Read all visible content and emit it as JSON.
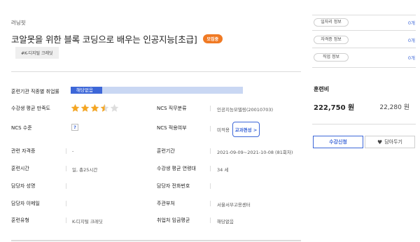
{
  "course": {
    "provider": "러닝핏",
    "title": "코알못을 위한 블록 코딩으로 배우는 인공지능[초급]",
    "badge": "모집중",
    "tag": "#K-디지털 크레딧"
  },
  "details": {
    "employment_rate_label": "훈련기관 직종별 취업률",
    "employment_rate_value": "해당없음",
    "satisfaction_label": "수강생 평균 만족도",
    "satisfaction_stars": 3.5,
    "satisfaction_max": 5,
    "ncs_level_label": "NCS 수준",
    "ncs_level_help": "?",
    "ncs_category_label": "NCS 직무분류",
    "ncs_category_value": "인공지능모델링(20010703)",
    "ncs_apply_label": "NCS 적용여부",
    "ncs_apply_value": "미적용",
    "curriculum_button": "교과편성 >",
    "cert_label": "관련 자격증",
    "cert_value": "-",
    "period_label": "훈련기간",
    "period_value": "2021-09-09~2021-10-08 (81회차)",
    "hours_label": "훈련시간",
    "hours_value": "일, 총25시간",
    "avg_age_label": "수강생 평균 연령대",
    "avg_age_value": "34 세",
    "manager_name_label": "담당자 성명",
    "manager_name_value": "",
    "manager_phone_label": "담당자 전화번호",
    "manager_phone_value": "",
    "manager_email_label": "담당자 이메일",
    "manager_email_value": "",
    "agency_label": "주관부처",
    "agency_value": "서울서부고용센터",
    "type_label": "훈련유형",
    "type_value": "K-디지털 크레딧",
    "wage_label": "취업처 임금평균",
    "wage_value": "해당없음"
  },
  "sidebar": {
    "info_rows": [
      {
        "label": "일자리 정보",
        "count": "0개"
      },
      {
        "label": "자격증 정보",
        "count": "0개"
      },
      {
        "label": "직업 정보",
        "count": "0개"
      }
    ],
    "fee_label": "훈련비",
    "fee_main": "222,750 원",
    "fee_sub": "22,280 원",
    "apply_button": "수강신청",
    "save_button": "담아두기"
  },
  "colors": {
    "accent": "#3d67d8",
    "accent_light": "#c9d7f3",
    "badge": "#f07a24",
    "star": "#f5a623"
  }
}
